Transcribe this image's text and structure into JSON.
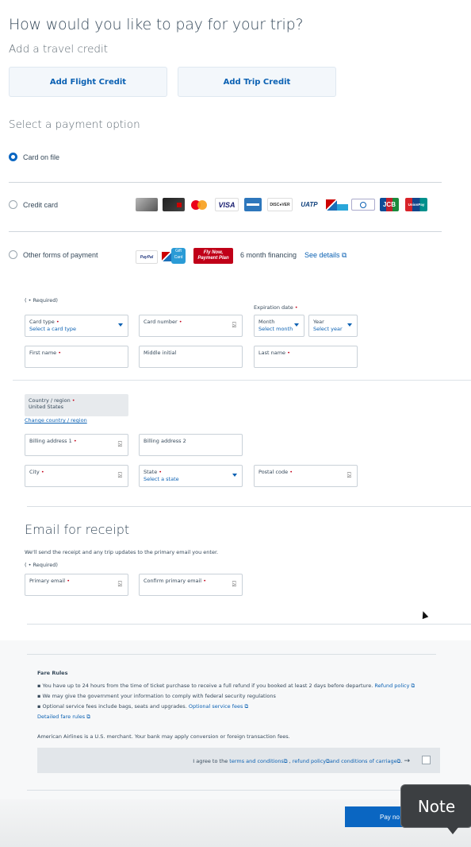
{
  "page": {
    "title": "How would you like to pay for your trip?",
    "travel_credit_heading": "Add a travel credit",
    "add_flight_credit": "Add Flight Credit",
    "add_trip_credit": "Add Trip Credit",
    "payment_option_heading": "Select a payment option"
  },
  "payment_options": {
    "card_on_file": "Card on file",
    "credit_card": "Credit card",
    "other_forms": "Other forms of payment",
    "financing": "6 month financing",
    "see_details": "See details",
    "card_brands": [
      "VISA",
      "DISC●VER",
      "UATP",
      "JCB",
      "UnionPay"
    ],
    "other_logos": [
      "PayPal",
      "Gift Card",
      "Fly Now, Payment Plan"
    ]
  },
  "card_form": {
    "required_note": "( • Required)",
    "card_type_label": "Card type",
    "card_type_value": "Select a card type",
    "card_number_label": "Card number",
    "expiration_label": "Expiration date",
    "month_label": "Month",
    "month_value": "Select month",
    "year_label": "Year",
    "year_value": "Select year",
    "first_name_label": "First name",
    "middle_initial_label": "Middle initial",
    "last_name_label": "Last name"
  },
  "billing": {
    "country_label": "Country / region",
    "country_value": "United States",
    "change_country": "Change country / region",
    "address1_label": "Billing address 1",
    "address2_label": "Billing address 2",
    "city_label": "City",
    "state_label": "State",
    "state_value": "Select a state",
    "postal_label": "Postal code"
  },
  "email": {
    "heading": "Email for receipt",
    "description": "We'll send the receipt and any trip updates to the primary email you enter.",
    "required_note": "( • Required)",
    "primary_label": "Primary email",
    "confirm_label": "Confirm primary email"
  },
  "fare_rules": {
    "heading": "Fare Rules",
    "rule1": "You have up to 24 hours from the time of ticket purchase to receive a full refund if you booked at least 2 days before departure.",
    "rule1_link": "Refund policy",
    "rule2": "We may give the government your information to comply with federal security regulations",
    "rule3": "Optional service fees include bags, seats and upgrades.",
    "rule3_link": "Optional service fees",
    "detailed_link": "Detailed fare rules",
    "merchant_note": "American Airlines is a U.S. merchant. Your bank may apply conversion or foreign transaction fees.",
    "agree_prefix": "I agree to the",
    "terms_link": "terms and conditions",
    "refund_link": "refund policy",
    "carriage_link": "and conditions of carriage",
    "arrow": "→"
  },
  "pay_button": "Pay no",
  "tooltip_note": "Note",
  "colors": {
    "accent": "#0b61b3",
    "pay_button": "#0a66c2",
    "required": "#c30019",
    "tooltip": "#3c3f42"
  }
}
